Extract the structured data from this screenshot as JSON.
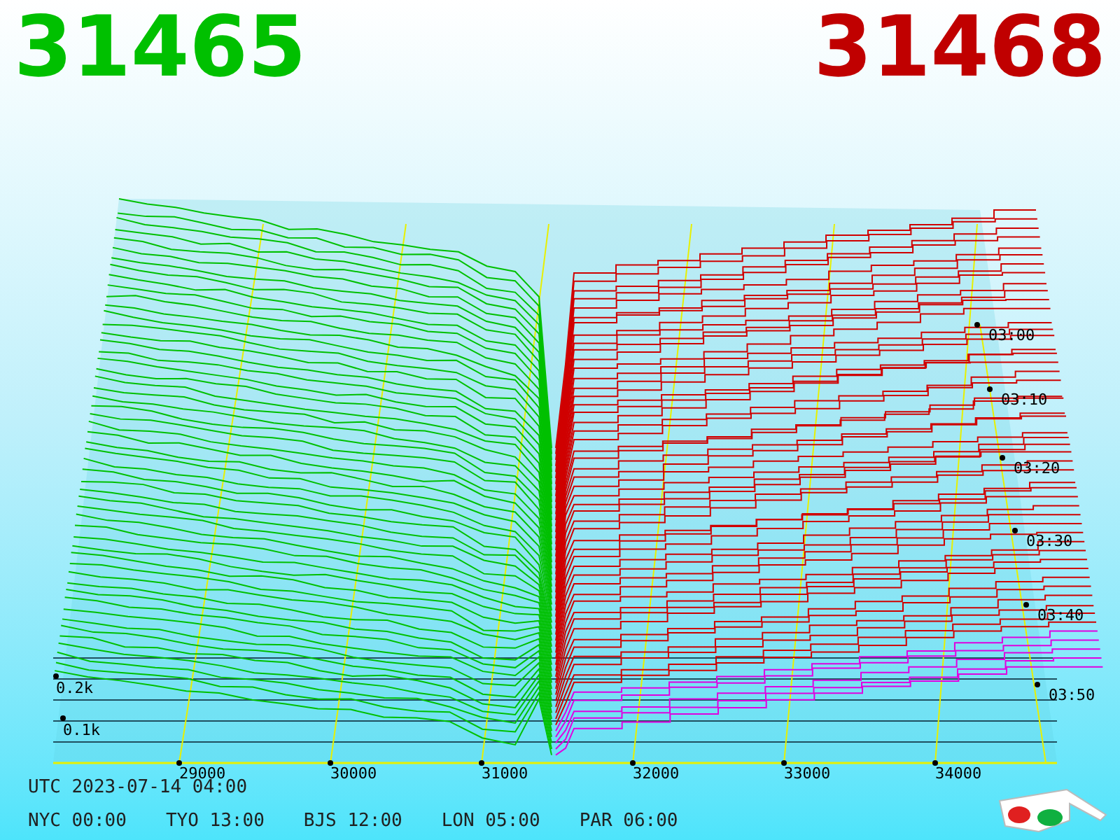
{
  "prices": {
    "bid": "31465",
    "ask": "31468"
  },
  "chart": {
    "price_ticks": [
      "29000",
      "30000",
      "31000",
      "32000",
      "33000",
      "34000"
    ],
    "time_ticks": [
      "03:00",
      "03:10",
      "03:20",
      "03:30",
      "03:40",
      "03:50"
    ],
    "volume_ticks": [
      "0.2k",
      "0.1k"
    ]
  },
  "footer": {
    "utc": "UTC 2023-07-14 04:00",
    "zones": [
      "NYC 00:00",
      "TYO 13:00",
      "BJS 12:00",
      "LON 05:00",
      "PAR 06:00"
    ]
  }
}
